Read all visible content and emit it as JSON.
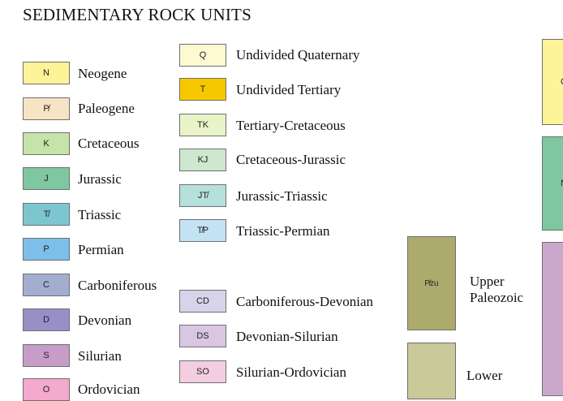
{
  "title": "SEDIMENTARY ROCK UNITS",
  "col1": [
    {
      "code": "N",
      "label": "Neogene",
      "color": "#fdf497"
    },
    {
      "code": "P̸",
      "label": "Paleogene",
      "color": "#f6e4c5"
    },
    {
      "code": "K",
      "label": "Cretaceous",
      "color": "#c6e4a9"
    },
    {
      "code": "J",
      "label": "Jurassic",
      "color": "#7fc7a0"
    },
    {
      "code": "T̸",
      "label": "Triassic",
      "color": "#7ec6cf"
    },
    {
      "code": "P",
      "label": "Permian",
      "color": "#7cbfe8"
    },
    {
      "code": "C",
      "label": "Carboniferous",
      "color": "#a3adcf"
    },
    {
      "code": "D",
      "label": "Devonian",
      "color": "#9690c6"
    },
    {
      "code": "S",
      "label": "Silurian",
      "color": "#c79cc8"
    },
    {
      "code": "O",
      "label": "Ordovician",
      "color": "#f4a9cf"
    }
  ],
  "col2": [
    {
      "code": "Q",
      "label": "Undivided Quaternary",
      "color": "#fdfad2"
    },
    {
      "code": "T",
      "label": "Undivided Tertiary",
      "color": "#f6c800"
    },
    {
      "code": "TK",
      "label": "Tertiary-Cretaceous",
      "color": "#e9f3c8"
    },
    {
      "code": "KJ",
      "label": "Cretaceous-Jurassic",
      "color": "#cfe6cf"
    },
    {
      "code": "JT̸",
      "label": "Jurassic-Triassic",
      "color": "#b5e0dc"
    },
    {
      "code": "T̸P",
      "label": "Triassic-Permian",
      "color": "#c3e3f5"
    }
  ],
  "col2b": [
    {
      "code": "CD",
      "label": "Carboniferous-Devonian",
      "color": "#d8d3e8"
    },
    {
      "code": "DS",
      "label": "Devonian-Silurian",
      "color": "#d9c6e1"
    },
    {
      "code": "SO",
      "label": "Silurian-Ordovician",
      "color": "#f5cde0"
    }
  ],
  "col3": [
    {
      "code": "P̸zu",
      "label_lines": [
        "Upper",
        "Paleozoic"
      ],
      "color": "#adaa6e"
    },
    {
      "code": "",
      "label_lines": [
        "Lower"
      ],
      "color": "#c9c99a"
    }
  ],
  "edge": [
    {
      "code": "Q",
      "color": "#fdf497"
    },
    {
      "code": "N",
      "color": "#7fc7a0"
    },
    {
      "code": "",
      "color": "#c9a8cc"
    }
  ]
}
